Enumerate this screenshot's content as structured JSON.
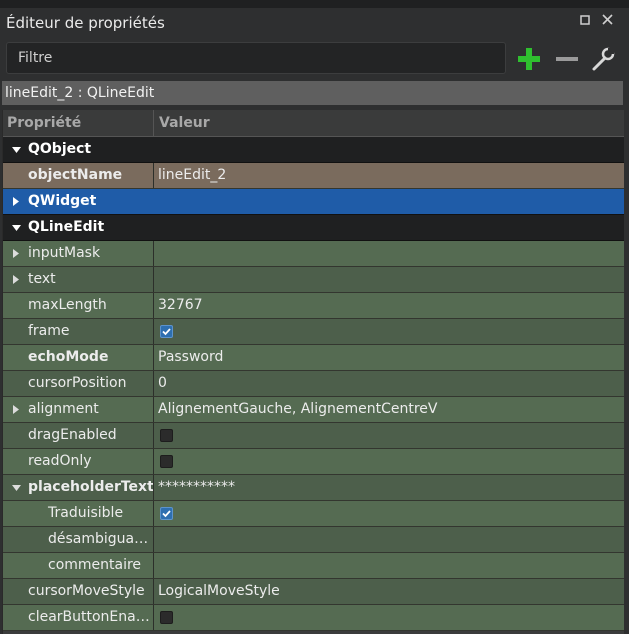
{
  "panel": {
    "title": "Éditeur de propriétés",
    "float_icon": "float-icon",
    "close_icon": "close-icon"
  },
  "filter": {
    "placeholder": "Filtre"
  },
  "toolbar": {
    "add_icon": "plus-icon",
    "remove_icon": "minus-icon",
    "configure_icon": "wrench-icon"
  },
  "object": {
    "label": "lineEdit_2 : QLineEdit"
  },
  "table": {
    "columns": [
      "Propriété",
      "Valeur"
    ],
    "rows": [
      {
        "kind": "group",
        "name": "QObject",
        "expanded": true,
        "bg": "#1f2021"
      },
      {
        "kind": "prop",
        "name": "objectName",
        "value": "lineEdit_2",
        "bold": true,
        "bg": "#7a6b5d"
      },
      {
        "kind": "group",
        "name": "QWidget",
        "expanded": false,
        "bg": "#1f5ca8"
      },
      {
        "kind": "group",
        "name": "QLineEdit",
        "expanded": true,
        "bg": "#1f2021"
      },
      {
        "kind": "prop",
        "name": "inputMask",
        "value": "",
        "arrow": "right",
        "bg": "#556b52"
      },
      {
        "kind": "prop",
        "name": "text",
        "value": "",
        "arrow": "right",
        "bg": "#4d5f4b"
      },
      {
        "kind": "prop",
        "name": "maxLength",
        "value": "32767",
        "bg": "#556b52"
      },
      {
        "kind": "prop",
        "name": "frame",
        "checkbox": true,
        "checked": true,
        "bg": "#4d5f4b"
      },
      {
        "kind": "prop",
        "name": "echoMode",
        "value": "Password",
        "bold": true,
        "bg": "#556b52"
      },
      {
        "kind": "prop",
        "name": "cursorPosition",
        "value": "0",
        "bg": "#4d5f4b"
      },
      {
        "kind": "prop",
        "name": "alignment",
        "value": "AlignementGauche, AlignementCentreV",
        "arrow": "right",
        "bg": "#556b52"
      },
      {
        "kind": "prop",
        "name": "dragEnabled",
        "checkbox": true,
        "checked": false,
        "bg": "#4d5f4b"
      },
      {
        "kind": "prop",
        "name": "readOnly",
        "checkbox": true,
        "checked": false,
        "bg": "#556b52"
      },
      {
        "kind": "prop",
        "name": "placeholderText",
        "value": "***********",
        "bold": true,
        "arrow": "down",
        "bg": "#4d5f4b"
      },
      {
        "kind": "sub",
        "name": "Traduisible",
        "checkbox": true,
        "checked": true,
        "bg": "#556b52"
      },
      {
        "kind": "sub",
        "name": "désambigua…",
        "value": "",
        "bg": "#4d5f4b"
      },
      {
        "kind": "sub",
        "name": "commentaire",
        "value": "",
        "bg": "#556b52"
      },
      {
        "kind": "prop",
        "name": "cursorMoveStyle",
        "value": "LogicalMoveStyle",
        "bg": "#4d5f4b"
      },
      {
        "kind": "prop",
        "name": "clearButtonEna…",
        "checkbox": true,
        "checked": false,
        "bg": "#556b52"
      }
    ]
  }
}
